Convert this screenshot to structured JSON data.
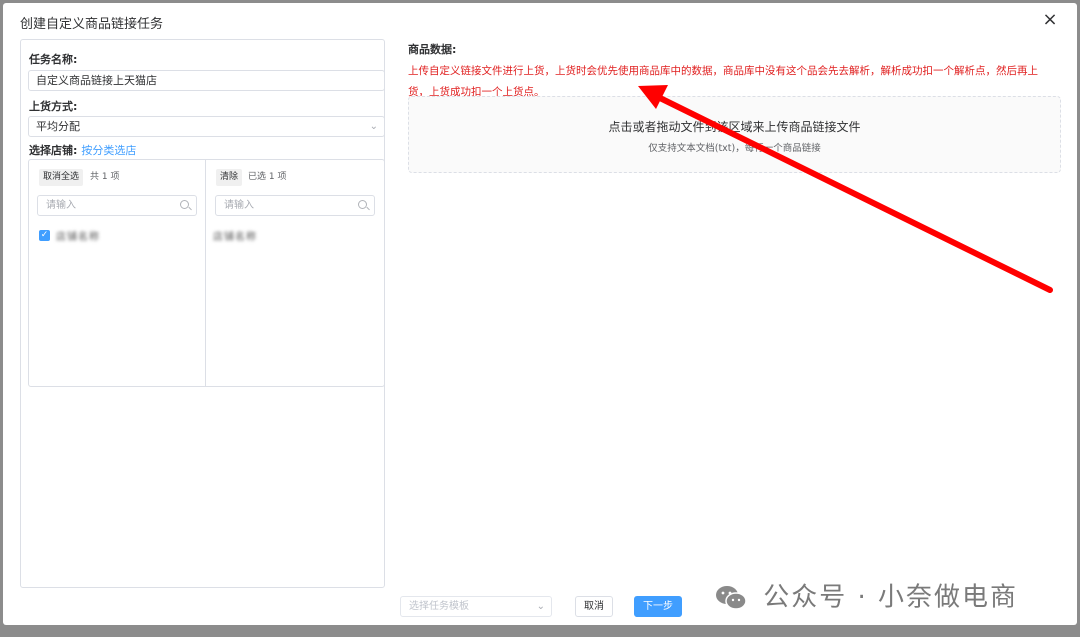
{
  "dialog": {
    "title": "创建自定义商品链接任务",
    "close_icon": "×"
  },
  "form": {
    "task_name_label": "任务名称:",
    "task_name_value": "自定义商品链接上天猫店",
    "method_label": "上货方式:",
    "method_value": "平均分配",
    "store_label": "选择店铺:",
    "store_link": "按分类选店"
  },
  "transfer": {
    "left": {
      "button": "取消全选",
      "count": "共 1 项",
      "search_placeholder": "请输入",
      "items": [
        "店铺名称"
      ]
    },
    "right": {
      "button": "清除",
      "count": "已选 1 项",
      "search_placeholder": "请输入",
      "items": [
        "店铺名称"
      ]
    }
  },
  "product_data": {
    "label": "商品数据:",
    "notice": "上传自定义链接文件进行上货，上货时会优先使用商品库中的数据，商品库中没有这个品会先去解析，解析成功扣一个解析点，然后再上货，上货成功扣一个上货点。",
    "upload_main": "点击或者拖动文件到该区域来上传商品链接文件",
    "upload_sub": "仅支持文本文档(txt)，每行一个商品链接"
  },
  "footer": {
    "template_placeholder": "选择任务模板",
    "cancel_label": "取消",
    "next_label": "下一步"
  },
  "watermark": {
    "text": "公众号 · 小奈做电商"
  },
  "colors": {
    "accent": "#409eff",
    "notice": "#e02020",
    "arrow": "#ff0000"
  }
}
